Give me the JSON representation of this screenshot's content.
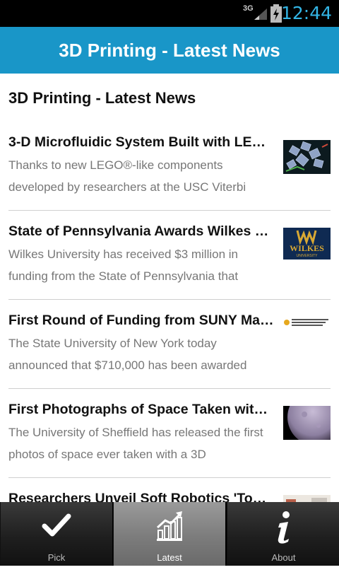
{
  "status_bar": {
    "network": "3G",
    "time": "12:44"
  },
  "app_bar": {
    "title": "3D Printing - Latest News"
  },
  "page": {
    "heading": "3D Printing - Latest News"
  },
  "articles": [
    {
      "title": "3-D Microfluidic System Built with LE…",
      "description": "Thanks to new LEGO®-like components developed by researchers at the USC Viterbi",
      "thumb": "microfluidic-thumbnail"
    },
    {
      "title": "State of Pennsylvania Awards Wilkes …",
      "description": "Wilkes University has received $3 million in funding from the State of Pennsylvania that",
      "thumb": "wilkes-logo",
      "thumb_text": "WILKES",
      "thumb_subtext": "UNIVERSITY"
    },
    {
      "title": "First Round of Funding from SUNY Ma…",
      "description": "The State University of New York today announced that $710,000 has been awarded",
      "thumb": "suny-logo"
    },
    {
      "title": "First Photographs of Space Taken wit…",
      "description": "The University of Sheffield has released the first photos of space ever taken with a 3D",
      "thumb": "moon-photo"
    },
    {
      "title": "Researchers Unveil Soft Robotics 'Too…",
      "description": "",
      "thumb": "soft-robotics-thumbnail"
    }
  ],
  "tabs": [
    {
      "label": "Pick",
      "icon": "checkmark-icon",
      "active": false
    },
    {
      "label": "Latest",
      "icon": "chart-icon",
      "active": true
    },
    {
      "label": "About",
      "icon": "info-icon",
      "active": false
    }
  ],
  "colors": {
    "app_bar": "#1996c8",
    "clock": "#33b5e5",
    "wilkes_bg": "#0f2a52",
    "wilkes_gold": "#d8a834"
  }
}
